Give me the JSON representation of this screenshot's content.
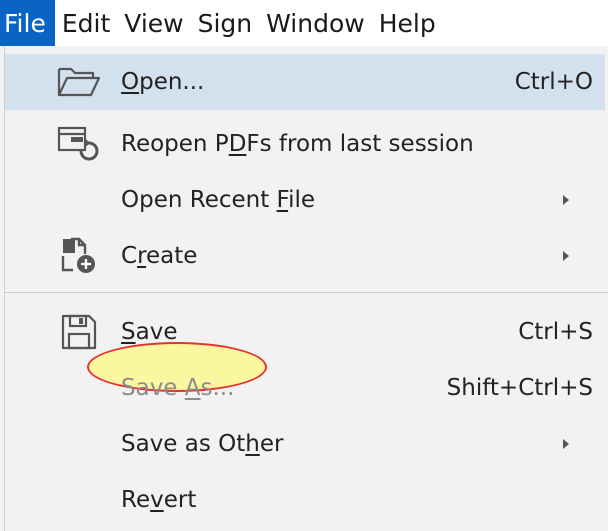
{
  "menubar": {
    "items": [
      {
        "label": "File",
        "active": true
      },
      {
        "label": "Edit"
      },
      {
        "label": "View"
      },
      {
        "label": "Sign"
      },
      {
        "label": "Window"
      },
      {
        "label": "Help"
      }
    ]
  },
  "file_menu": {
    "open": {
      "pre": "",
      "mnemonic": "O",
      "post": "pen...",
      "shortcut": "Ctrl+O",
      "icon": "folder-open-icon"
    },
    "reopen": {
      "pre": "Reopen P",
      "mnemonic": "D",
      "post": "Fs from last session",
      "icon": "reopen-session-icon"
    },
    "open_recent": {
      "pre": "Open Recent ",
      "mnemonic": "F",
      "post": "ile"
    },
    "create": {
      "pre": "C",
      "mnemonic": "r",
      "post": "eate",
      "icon": "create-pdf-icon"
    },
    "save": {
      "pre": "",
      "mnemonic": "S",
      "post": "ave",
      "shortcut": "Ctrl+S",
      "icon": "floppy-save-icon"
    },
    "save_as": {
      "pre": "Save ",
      "mnemonic": "A",
      "post": "s...",
      "shortcut": "Shift+Ctrl+S"
    },
    "save_as_other": {
      "pre": "Save as Ot",
      "mnemonic": "h",
      "post": "er"
    },
    "revert": {
      "pre": "Re",
      "mnemonic": "v",
      "post": "ert"
    }
  },
  "colors": {
    "active_menu": "#0a64c6",
    "highlight_row": "#d3e0ee",
    "annotation_stroke": "#e8312d",
    "annotation_fill": "#fbf7a1"
  }
}
